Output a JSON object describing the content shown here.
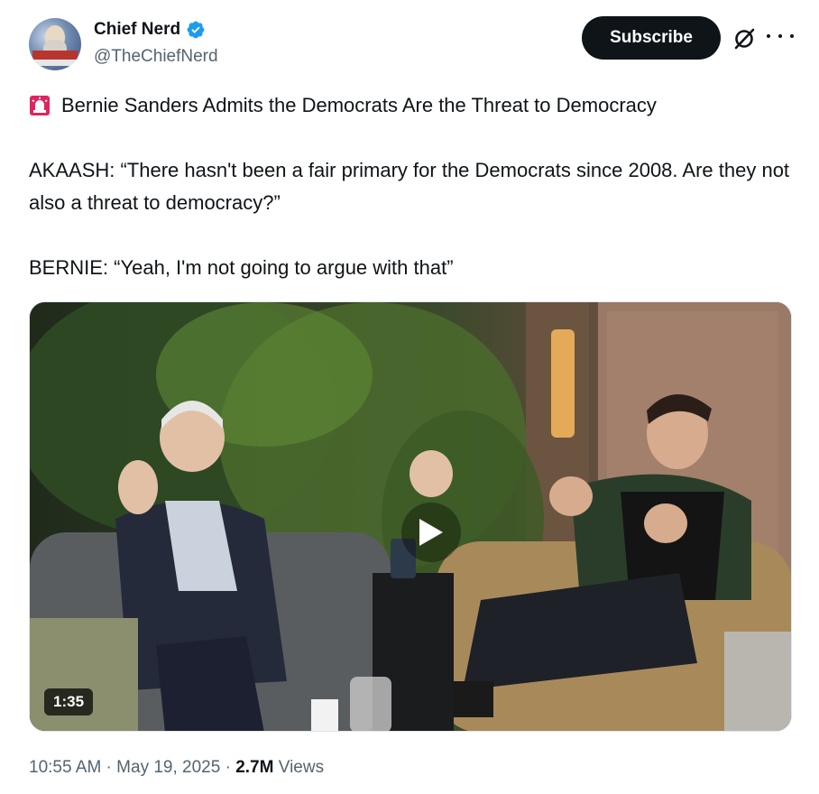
{
  "author": {
    "name": "Chief Nerd",
    "handle": "@TheChiefNerd",
    "verified_icon": "verified-badge-icon",
    "verified_color": "#1d9bf0"
  },
  "actions": {
    "subscribe_label": "Subscribe",
    "grok_icon": "grok-icon",
    "more_icon": "more-options-icon"
  },
  "post": {
    "headline_icon": "siren-icon",
    "headline": "Bernie Sanders Admits the Democrats Are the Threat to Democracy",
    "line_akaash": "AKAASH: “There hasn't been a fair primary for the Democrats since 2008. Are they not also a threat to democracy?”",
    "line_bernie": "BERNIE: “Yeah, I'm not going to argue with that”"
  },
  "video": {
    "duration": "1:35",
    "play_icon": "play-icon"
  },
  "meta": {
    "time": "10:55 AM",
    "separator": " · ",
    "date": "May 19, 2025",
    "views_count": "2.7M",
    "views_label": "Views"
  },
  "colors": {
    "text_primary": "#0f1419",
    "text_secondary": "#536471",
    "button_bg": "#0f1419",
    "siren_red": "#e0245e"
  }
}
